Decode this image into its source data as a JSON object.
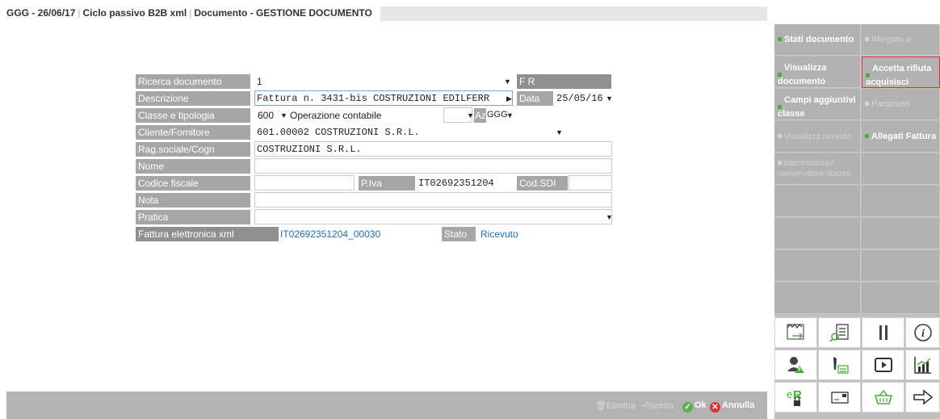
{
  "title": {
    "part1": "GGG - 26/06/17",
    "part2": "Ciclo passivo B2B xml",
    "part3": "Documento - GESTIONE DOCUMENTO"
  },
  "form": {
    "ricerca": {
      "label": "Ricerca documento",
      "value": "1",
      "fr": "F R"
    },
    "descrizione": {
      "label": "Descrizione",
      "value": "Fattura n. 3431-bis COSTRUZIONI EDILFERR",
      "data_label": "Data",
      "data_value": "25/05/16"
    },
    "classe": {
      "label": "Classe e tipologia",
      "code": "600",
      "tipo": "Operazione contabile",
      "az_label": "Az",
      "az_value": "GGG"
    },
    "cliente": {
      "label": "Cliente/Fornitore",
      "value": "601.00002 COSTRUZIONI S.R.L."
    },
    "ragsoc": {
      "label": "Rag.sociale/Cogn",
      "value": "COSTRUZIONI S.R.L."
    },
    "nome": {
      "label": "Nome",
      "value": ""
    },
    "codfisc": {
      "label": "Codice fiscale",
      "value": "",
      "piva_label": "P.Iva",
      "piva_value": "IT02692351204",
      "sdi_label": "Cod.SDI",
      "sdi_value": ""
    },
    "nota": {
      "label": "Nota",
      "value": ""
    },
    "pratica": {
      "label": "Pratica",
      "value": ""
    },
    "fattura": {
      "label": "Fattura elettronica xml",
      "value": "IT02692351204_00030",
      "stato_label": "Stato",
      "stato_value": "Ricevuto"
    }
  },
  "bottom": {
    "elimina": "Elimina",
    "scelta": "Scelta",
    "ok": "Ok",
    "annulla": "Annulla"
  },
  "side": {
    "stati_documento": "Stati documento",
    "allegato_a": "Allegato a",
    "visualizza_documento_1": "Visualizza",
    "visualizza_documento_2": "documento",
    "accetta_1": "Accetta rifiuta",
    "accetta_2": "acquisisci",
    "campi_1": "Campi aggiuntivi",
    "campi_2": "classe",
    "parametri": "Parametri",
    "visualizza_ricevuta": "Visualizza ricevuta",
    "allegati_fattura": "Allegati Fattura",
    "intermediario_1": "Intermediario/",
    "intermediario_2": "conservatore docum"
  },
  "colors": {
    "accent_green": "#4caf3c",
    "link_blue": "#1c6fb5",
    "highlight_red": "#e0332e",
    "label_gray": "#a6a6a6"
  }
}
